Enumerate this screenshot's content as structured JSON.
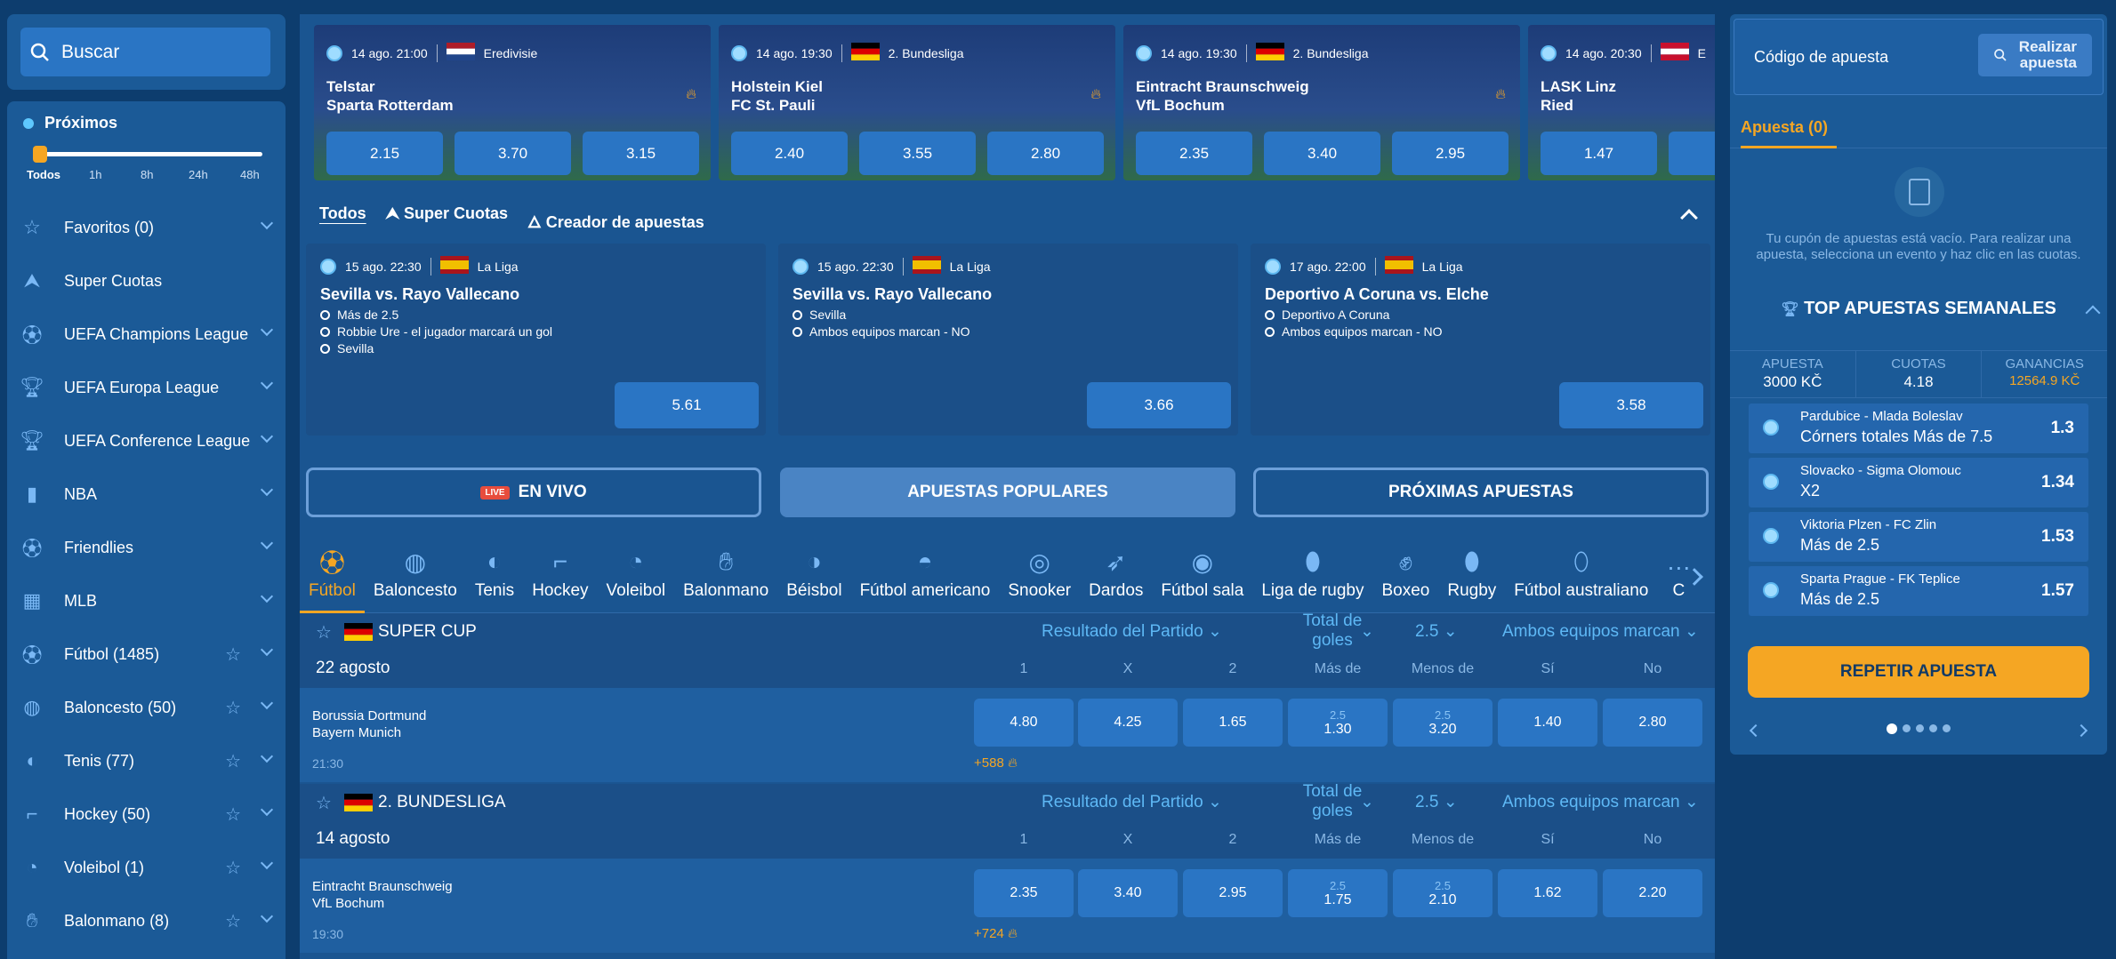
{
  "search": {
    "label": "Buscar"
  },
  "upcoming": {
    "title": "Próximos",
    "ticks": [
      "Todos",
      "1h",
      "8h",
      "24h",
      "48h"
    ],
    "level": 0
  },
  "nav": [
    {
      "label": "Favoritos (0)",
      "icon": "star-icon",
      "chev": true,
      "star": false
    },
    {
      "label": "Super Cuotas",
      "icon": "super-cuotas-icon",
      "chev": false,
      "star": false
    },
    {
      "label": "UEFA Champions League",
      "icon": "football-icon",
      "chev": true,
      "star": false
    },
    {
      "label": "UEFA Europa League",
      "icon": "trophy-icon",
      "chev": true,
      "star": false
    },
    {
      "label": "UEFA Conference League",
      "icon": "trophy-icon",
      "chev": true,
      "star": false
    },
    {
      "label": "NBA",
      "icon": "nba-icon",
      "chev": true,
      "star": false
    },
    {
      "label": "Friendlies",
      "icon": "football-icon",
      "chev": true,
      "star": false
    },
    {
      "label": "MLB",
      "icon": "mlb-icon",
      "chev": true,
      "star": false
    },
    {
      "label": "Fútbol (1485)",
      "icon": "football-icon",
      "chev": true,
      "star": true
    },
    {
      "label": "Baloncesto (50)",
      "icon": "basketball-icon",
      "chev": true,
      "star": true
    },
    {
      "label": "Tenis (77)",
      "icon": "tennis-icon",
      "chev": true,
      "star": true
    },
    {
      "label": "Hockey (50)",
      "icon": "hockey-icon",
      "chev": true,
      "star": true
    },
    {
      "label": "Voleibol (1)",
      "icon": "volleyball-icon",
      "chev": true,
      "star": true
    },
    {
      "label": "Balonmano (8)",
      "icon": "handball-icon",
      "chev": true,
      "star": true
    }
  ],
  "featured": [
    {
      "time": "14 ago. 21:00",
      "league": "Eredivisie",
      "flag": "nl",
      "team1": "Telstar",
      "team2": "Sparta Rotterdam",
      "odds": [
        "2.15",
        "3.70",
        "3.15"
      ],
      "hot": true
    },
    {
      "time": "14 ago. 19:30",
      "league": "2. Bundesliga",
      "flag": "de",
      "team1": "Holstein Kiel",
      "team2": "FC St. Pauli",
      "odds": [
        "2.40",
        "3.55",
        "2.80"
      ],
      "hot": true
    },
    {
      "time": "14 ago. 19:30",
      "league": "2. Bundesliga",
      "flag": "de",
      "team1": "Eintracht Braunschweig",
      "team2": "VfL Bochum",
      "odds": [
        "2.35",
        "3.40",
        "2.95"
      ],
      "hot": true
    },
    {
      "time": "14 ago. 20:30",
      "league": "E",
      "flag": "at",
      "team1": "LASK Linz",
      "team2": "Ried",
      "odds": [
        "1.47",
        "",
        ""
      ],
      "hot": false
    }
  ],
  "filters": [
    "Todos",
    "Super Cuotas",
    "Creador de apuestas"
  ],
  "combos": [
    {
      "time": "15 ago. 22:30",
      "league": "La Liga",
      "title": "Sevilla vs. Rayo Vallecano",
      "legs": [
        "Más de  2.5",
        "Robbie Ure - el jugador marcará un gol",
        "Sevilla"
      ],
      "odd": "5.61"
    },
    {
      "time": "15 ago. 22:30",
      "league": "La Liga",
      "title": "Sevilla vs. Rayo Vallecano",
      "legs": [
        "Sevilla",
        "Ambos equipos marcan - NO"
      ],
      "odd": "3.66"
    },
    {
      "time": "17 ago. 22:00",
      "league": "La Liga",
      "title": "Deportivo A Coruna vs. Elche",
      "legs": [
        "Deportivo A Coruna",
        "Ambos equipos marcan - NO"
      ],
      "odd": "3.58"
    }
  ],
  "buttons": {
    "live_badge": "LIVE",
    "live": "EN VIVO",
    "popular": "APUESTAS POPULARES",
    "upcoming": "PRÓXIMAS APUESTAS"
  },
  "sports": [
    {
      "label": "Fútbol",
      "icon": "football-icon",
      "active": true
    },
    {
      "label": "Baloncesto",
      "icon": "basketball-icon"
    },
    {
      "label": "Tenis",
      "icon": "tennis-icon"
    },
    {
      "label": "Hockey",
      "icon": "hockey-icon"
    },
    {
      "label": "Voleibol",
      "icon": "volleyball-icon"
    },
    {
      "label": "Balonmano",
      "icon": "handball-icon"
    },
    {
      "label": "Béisbol",
      "icon": "baseball-icon"
    },
    {
      "label": "Fútbol americano",
      "icon": "helmet-icon"
    },
    {
      "label": "Snooker",
      "icon": "snooker-icon"
    },
    {
      "label": "Dardos",
      "icon": "darts-icon"
    },
    {
      "label": "Fútbol sala",
      "icon": "futsal-icon"
    },
    {
      "label": "Liga de rugby",
      "icon": "rugby-icon"
    },
    {
      "label": "Boxeo",
      "icon": "boxing-icon"
    },
    {
      "label": "Rugby",
      "icon": "rugby-icon"
    },
    {
      "label": "Fútbol australiano",
      "icon": "aussie-rules-icon"
    },
    {
      "label": "C",
      "icon": "more-icon"
    }
  ],
  "markets": {
    "result": "Resultado del Partido",
    "total": "Total de goles",
    "line": "2.5",
    "btts": "Ambos equipos marcan",
    "cols": [
      "1",
      "X",
      "2",
      "Más de",
      "Menos de",
      "Sí",
      "No"
    ]
  },
  "leagues": [
    {
      "name": "SUPER CUP",
      "flag": "de",
      "date": "22 agosto",
      "match": {
        "team1": "Borussia Dortmund",
        "team2": "Bayern Munich",
        "time": "21:30",
        "more": "+588",
        "odds": [
          "4.80",
          "4.25",
          "1.65",
          "1.30",
          "3.20",
          "1.40",
          "2.80"
        ],
        "lines": [
          "",
          "",
          "",
          "2.5",
          "2.5",
          "",
          ""
        ]
      }
    },
    {
      "name": "2. BUNDESLIGA",
      "flag": "de",
      "date": "14 agosto",
      "match": {
        "team1": "Eintracht Braunschweig",
        "team2": "VfL Bochum",
        "time": "19:30",
        "more": "+724",
        "odds": [
          "2.35",
          "3.40",
          "2.95",
          "1.75",
          "2.10",
          "1.62",
          "2.20"
        ],
        "lines": [
          "",
          "",
          "",
          "2.5",
          "2.5",
          "",
          ""
        ]
      }
    }
  ],
  "betslip": {
    "code_label": "Código de apuesta",
    "realizar": "Realizar apuesta",
    "tab": "Apuesta (0)",
    "empty": "Tu cupón de apuestas está vacío. Para realizar una apuesta, selecciona un evento y haz clic en las cuotas.",
    "top_title": "TOP APUESTAS SEMANALES",
    "stats": [
      {
        "k": "APUESTA",
        "v": "3000 KČ"
      },
      {
        "k": "CUOTAS",
        "v": "4.18"
      },
      {
        "k": "GANANCIAS",
        "v": "12564.9 KČ"
      }
    ],
    "top": [
      {
        "match": "Pardubice - Mlada Boleslav",
        "pick": "Córners totales Más de 7.5",
        "odd": "1.3"
      },
      {
        "match": "Slovacko - Sigma Olomouc",
        "pick": "X2",
        "odd": "1.34"
      },
      {
        "match": "Viktoria Plzen - FC Zlin",
        "pick": "Más de 2.5",
        "odd": "1.53"
      },
      {
        "match": "Sparta Prague - FK Teplice",
        "pick": "Más de 2.5",
        "odd": "1.57"
      }
    ],
    "repeat": "REPETIR APUESTA",
    "page": 1,
    "pages": 5
  },
  "colors": {
    "accent": "#f5a623",
    "odd_bg": "#2a75c4",
    "panel": "#1b5a97"
  }
}
